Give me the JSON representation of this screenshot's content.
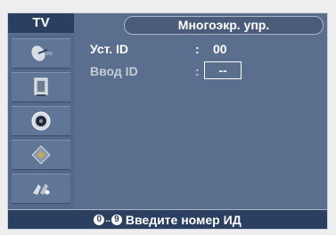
{
  "header": {
    "tv_label": "TV",
    "title": "Многоэкр. упр."
  },
  "sidebar": {
    "items": [
      {
        "icon": "satellite-dish-icon"
      },
      {
        "icon": "tv-screen-icon"
      },
      {
        "icon": "speaker-icon"
      },
      {
        "icon": "channel-chip-icon"
      },
      {
        "icon": "setup-settings-icon"
      }
    ]
  },
  "main": {
    "set_id": {
      "label": "Уст. ID",
      "colon": ":",
      "value": "00"
    },
    "enter_id": {
      "label": "Ввод ID",
      "colon": ":",
      "value": "--"
    }
  },
  "footer": {
    "range_start": "0",
    "range_sep": "..",
    "range_end": "9",
    "hint": "Введите номер ИД"
  },
  "colors": {
    "panel": "#5a6f8e",
    "header_bar": "#2b3f60",
    "text": "#ffffff"
  }
}
